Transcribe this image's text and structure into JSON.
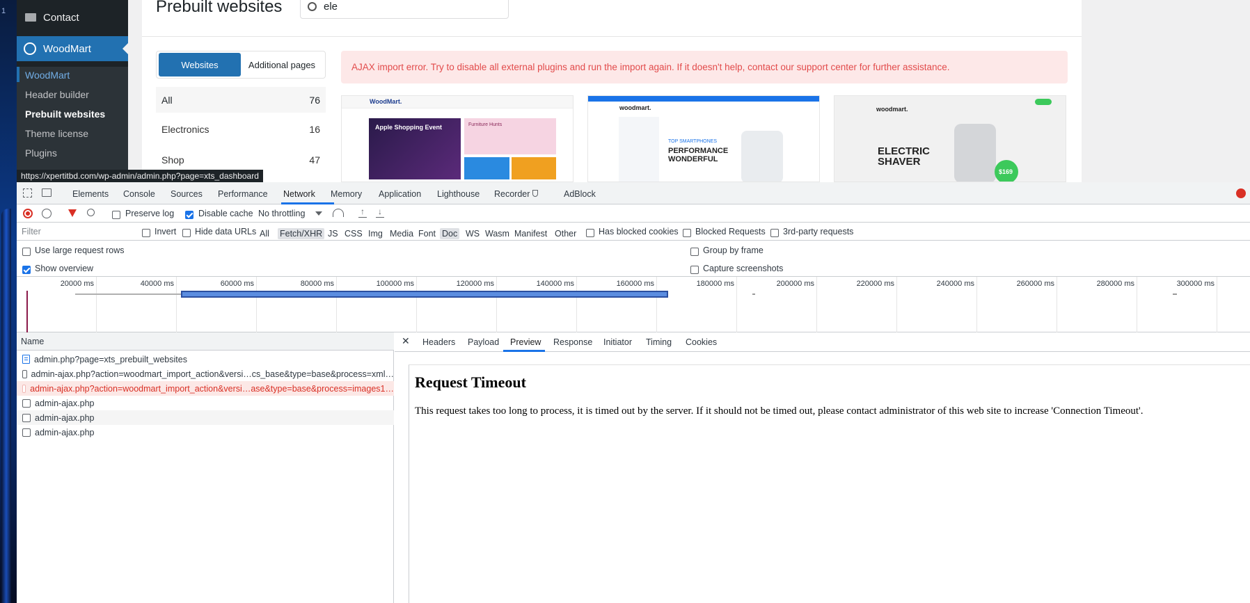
{
  "desktop": {
    "edge_label": "1"
  },
  "wp_sidebar": {
    "contact": "Contact",
    "woodmart": "WoodMart",
    "submenu": [
      "WoodMart",
      "Header builder",
      "Prebuilt websites",
      "Theme license",
      "Plugins"
    ]
  },
  "page": {
    "title": "Prebuilt websites",
    "search_value": "ele",
    "tabs": [
      "Websites",
      "Additional pages"
    ],
    "categories": [
      {
        "label": "All",
        "count": "76"
      },
      {
        "label": "Electronics",
        "count": "16"
      },
      {
        "label": "Shop",
        "count": "47"
      }
    ],
    "alert": "AJAX import error. Try to disable all external plugins and run the import again. If it doesn't help, contact our support center for further assistance.",
    "thumbs": [
      {
        "brand": "WoodMart.",
        "headline": "Apple Shopping Event",
        "sub": "Furniture Hunts"
      },
      {
        "brand": "woodmart.",
        "headline": "PERFORMANCE WONDERFUL",
        "sub": "TOP SMARTPHONES"
      },
      {
        "brand": "woodmart.",
        "headline": "ELECTRIC SHAVER",
        "sub": "$169"
      }
    ],
    "status_url": "https://xpertitbd.com/wp-admin/admin.php?page=xts_dashboard"
  },
  "devtools": {
    "tabs": [
      "Elements",
      "Console",
      "Sources",
      "Performance",
      "Network",
      "Memory",
      "Application",
      "Lighthouse",
      "Recorder",
      "AdBlock"
    ],
    "active_tab": "Network",
    "toolbar": {
      "preserve_log": "Preserve log",
      "disable_cache": "Disable cache",
      "throttling": "No throttling"
    },
    "filter": {
      "placeholder": "Filter",
      "invert": "Invert",
      "hide_data_urls": "Hide data URLs",
      "types": [
        "All",
        "Fetch/XHR",
        "JS",
        "CSS",
        "Img",
        "Media",
        "Font",
        "Doc",
        "WS",
        "Wasm",
        "Manifest",
        "Other"
      ],
      "has_blocked_cookies": "Has blocked cookies",
      "blocked_requests": "Blocked Requests",
      "third_party": "3rd-party requests"
    },
    "options": {
      "large_rows": "Use large request rows",
      "show_overview": "Show overview",
      "group_by_frame": "Group by frame",
      "capture_screenshots": "Capture screenshots"
    },
    "overview_ticks": [
      "20000 ms",
      "40000 ms",
      "60000 ms",
      "80000 ms",
      "100000 ms",
      "120000 ms",
      "140000 ms",
      "160000 ms",
      "180000 ms",
      "200000 ms",
      "220000 ms",
      "240000 ms",
      "260000 ms",
      "280000 ms",
      "300000 ms"
    ],
    "name_header": "Name",
    "requests": [
      "admin.php?page=xts_prebuilt_websites",
      "admin-ajax.php?action=woodmart_import_action&versi…cs_base&type=base&process=xml…",
      "admin-ajax.php?action=woodmart_import_action&versi…ase&type=base&process=images1…",
      "admin-ajax.php",
      "admin-ajax.php",
      "admin-ajax.php"
    ],
    "preview_tabs": [
      "Headers",
      "Payload",
      "Preview",
      "Response",
      "Initiator",
      "Timing",
      "Cookies"
    ],
    "active_preview_tab": "Preview",
    "preview": {
      "heading": "Request Timeout",
      "body": "This request takes too long to process, it is timed out by the server. If it should not be timed out, please contact administrator of this web site to increase 'Connection Timeout'."
    }
  }
}
